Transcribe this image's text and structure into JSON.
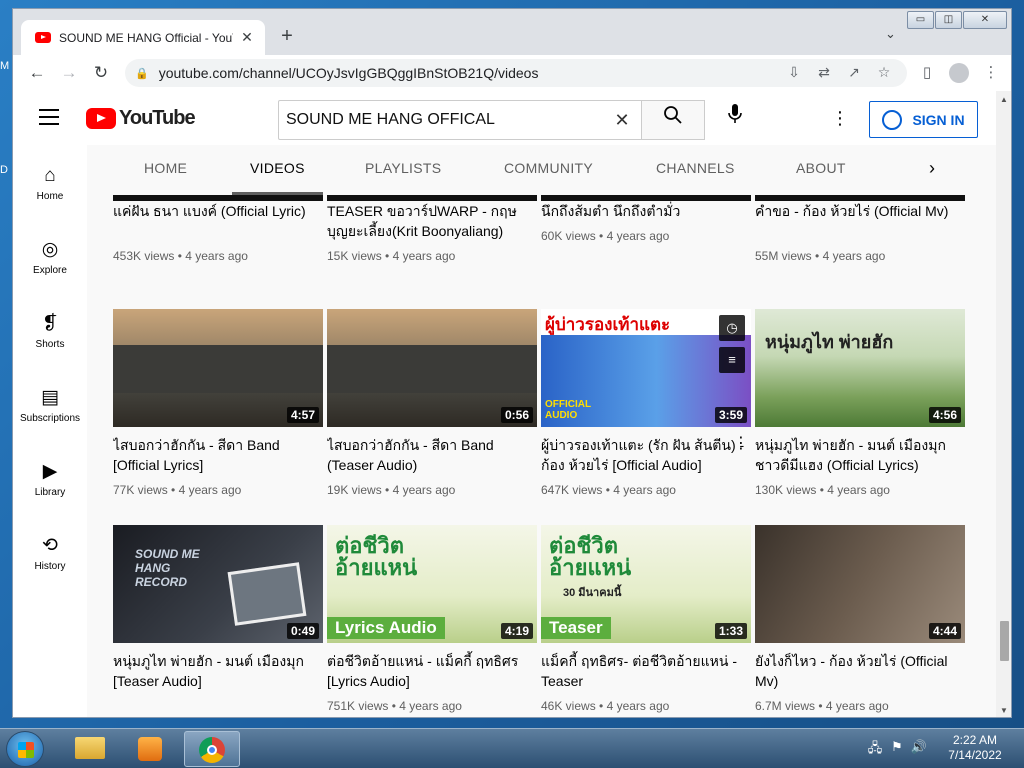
{
  "desktop": {
    "left_glyph_1": "M",
    "left_glyph_2": "D"
  },
  "browser": {
    "tab_title": "SOUND ME HANG Official - YouT",
    "tab_close": "✕",
    "new_tab": "+",
    "tab_search": "⌄",
    "url": "youtube.com/channel/UCOyJsvIgGBQggIBnStOB21Q/videos",
    "window_controls": {
      "minimize": "▭",
      "restore": "◫",
      "close": "✕"
    }
  },
  "youtube": {
    "logo_text": "YouTube",
    "search_query": "SOUND ME HANG OFFICAL",
    "sign_in": "SIGN IN",
    "guide": [
      {
        "label": "Home",
        "icon": "home-icon"
      },
      {
        "label": "Explore",
        "icon": "explore-icon"
      },
      {
        "label": "Shorts",
        "icon": "shorts-icon"
      },
      {
        "label": "Subscriptions",
        "icon": "subscriptions-icon"
      },
      {
        "label": "Library",
        "icon": "library-icon"
      },
      {
        "label": "History",
        "icon": "history-icon"
      }
    ],
    "channel_tabs": [
      "HOME",
      "VIDEOS",
      "PLAYLISTS",
      "COMMUNITY",
      "CHANNELS",
      "ABOUT"
    ],
    "active_tab": "VIDEOS",
    "videos_row0": [
      {
        "title": "แค่ฝัน ธนา แบงค์ (Official Lyric)",
        "views": "453K views",
        "age": "4 years ago"
      },
      {
        "title": "TEASER ขอวาร์ปWARP - กฤษ บุญยะเลี้ยง(Krit Boonyaliang)",
        "views": "15K views",
        "age": "4 years ago"
      },
      {
        "title": "นึกถึงส้มตำ นึกถึงตำมั่ว",
        "views": "60K views",
        "age": "4 years ago"
      },
      {
        "title": "คำขอ - ก้อง ห้วยไร่ (Official Mv)",
        "views": "55M views",
        "age": "4 years ago"
      }
    ],
    "videos_row1": [
      {
        "title": "ไสบอกว่าฮักกัน - สีดา Band [Official Lyrics]",
        "views": "77K views",
        "age": "4 years ago",
        "duration": "4:57"
      },
      {
        "title": "ไสบอกว่าฮักกัน - สีดา Band (Teaser Audio)",
        "views": "19K views",
        "age": "4 years ago",
        "duration": "0:56"
      },
      {
        "title": "ผู้บ่าวรองเท้าแตะ (รัก ฝัน ส้นตีน) - ก้อง ห้วยไร่ [Official Audio]",
        "views": "647K views",
        "age": "4 years ago",
        "duration": "3:59"
      },
      {
        "title": "หนุ่มภูไท พ่ายฮัก - มนต์ เมืองมุก ชาวดีมีแฮง (Official Lyrics)",
        "views": "130K views",
        "age": "4 years ago",
        "duration": "4:56"
      }
    ],
    "videos_row2": [
      {
        "title": "หนุ่มภูไท พ่ายฮัก - มนต์ เมืองมุก [Teaser Audio]",
        "views": "",
        "age": "",
        "duration": "0:49"
      },
      {
        "title": "ต่อชีวิตอ้ายแหน่ - แม็คกี้ ฤทธิศร [Lyrics Audio]",
        "views": "751K views",
        "age": "4 years ago",
        "duration": "4:19"
      },
      {
        "title": "แม็คกี้ ฤทธิศร- ต่อชีวิตอ้ายแหน่ - Teaser",
        "views": "46K views",
        "age": "4 years ago",
        "duration": "1:33"
      },
      {
        "title": "ยังไงก็ไหว - ก้อง ห้วยไร่ (Official Mv)",
        "views": "6.7M views",
        "age": "4 years ago",
        "duration": "4:44"
      }
    ],
    "thumb_overlays": {
      "r1c3_title": "ผู้บ่าวรองเท้าแตะ",
      "r1c3_badge": "OFFICIAL AUDIO",
      "r1c4_title": "หนุ่มภูไท พ่ายฮัก",
      "r2c1_logo": "SOUND ME HANG RECORD",
      "r2c2_title": "ต่อชีวิต อ้ายแหน่",
      "r2c2_badge": "Lyrics Audio",
      "r2c3_title": "ต่อชีวิต อ้ายแหน่",
      "r2c3_sub": "30 มีนาคมนี้",
      "r2c3_badge": "Teaser"
    }
  },
  "taskbar": {
    "time": "2:22 AM",
    "date": "7/14/2022"
  },
  "colors": {
    "yt_red": "#ff0000",
    "link_blue": "#065fd4",
    "taskbar": "#2c4f72"
  }
}
